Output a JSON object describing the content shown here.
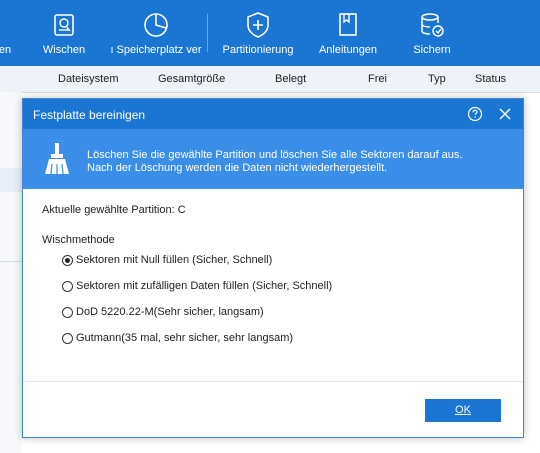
{
  "toolbar": {
    "items": [
      {
        "label": "en",
        "icon": "partial-icon"
      },
      {
        "label": "Wischen",
        "icon": "wipe-disk-icon"
      },
      {
        "label": "ı Speicherplatz ver",
        "icon": "pie-chart-icon"
      },
      {
        "label": "Partitionierung",
        "icon": "shield-plus-icon"
      },
      {
        "label": "Anleitungen",
        "icon": "book-icon"
      },
      {
        "label": "Sichern",
        "icon": "database-backup-icon"
      }
    ],
    "background": "#1a76d2"
  },
  "columns": [
    "Dateisystem",
    "Gesamtgröße",
    "Belegt",
    "Frei",
    "Typ",
    "Status"
  ],
  "dialog": {
    "title": "Festplatte bereinigen",
    "help_icon": "help-icon",
    "close_icon": "close-icon",
    "banner": {
      "icon": "broom-icon",
      "line1": "Löschen Sie die gewählte Partition und löschen Sie alle Sektoren darauf aus.",
      "line2": "Nach der Löschung werden die Daten nicht wiederhergestellt."
    },
    "partition_label": "Aktuelle gewählte Partition: C",
    "method_label": "Wischmethode",
    "methods": [
      {
        "label": "Sektoren mit Null füllen (Sicher, Schnell)",
        "selected": true
      },
      {
        "label": "Sektoren mit zufälligen Daten füllen (Sicher, Schnell)",
        "selected": false
      },
      {
        "label": "DoD 5220.22-M(Sehr sicher, langsam)",
        "selected": false
      },
      {
        "label": "Gutmann(35 mal, sehr sicher, sehr langsam)",
        "selected": false
      }
    ],
    "ok_label": "OK"
  },
  "colors": {
    "accent": "#1a76d2",
    "banner": "#3b8ee8"
  }
}
